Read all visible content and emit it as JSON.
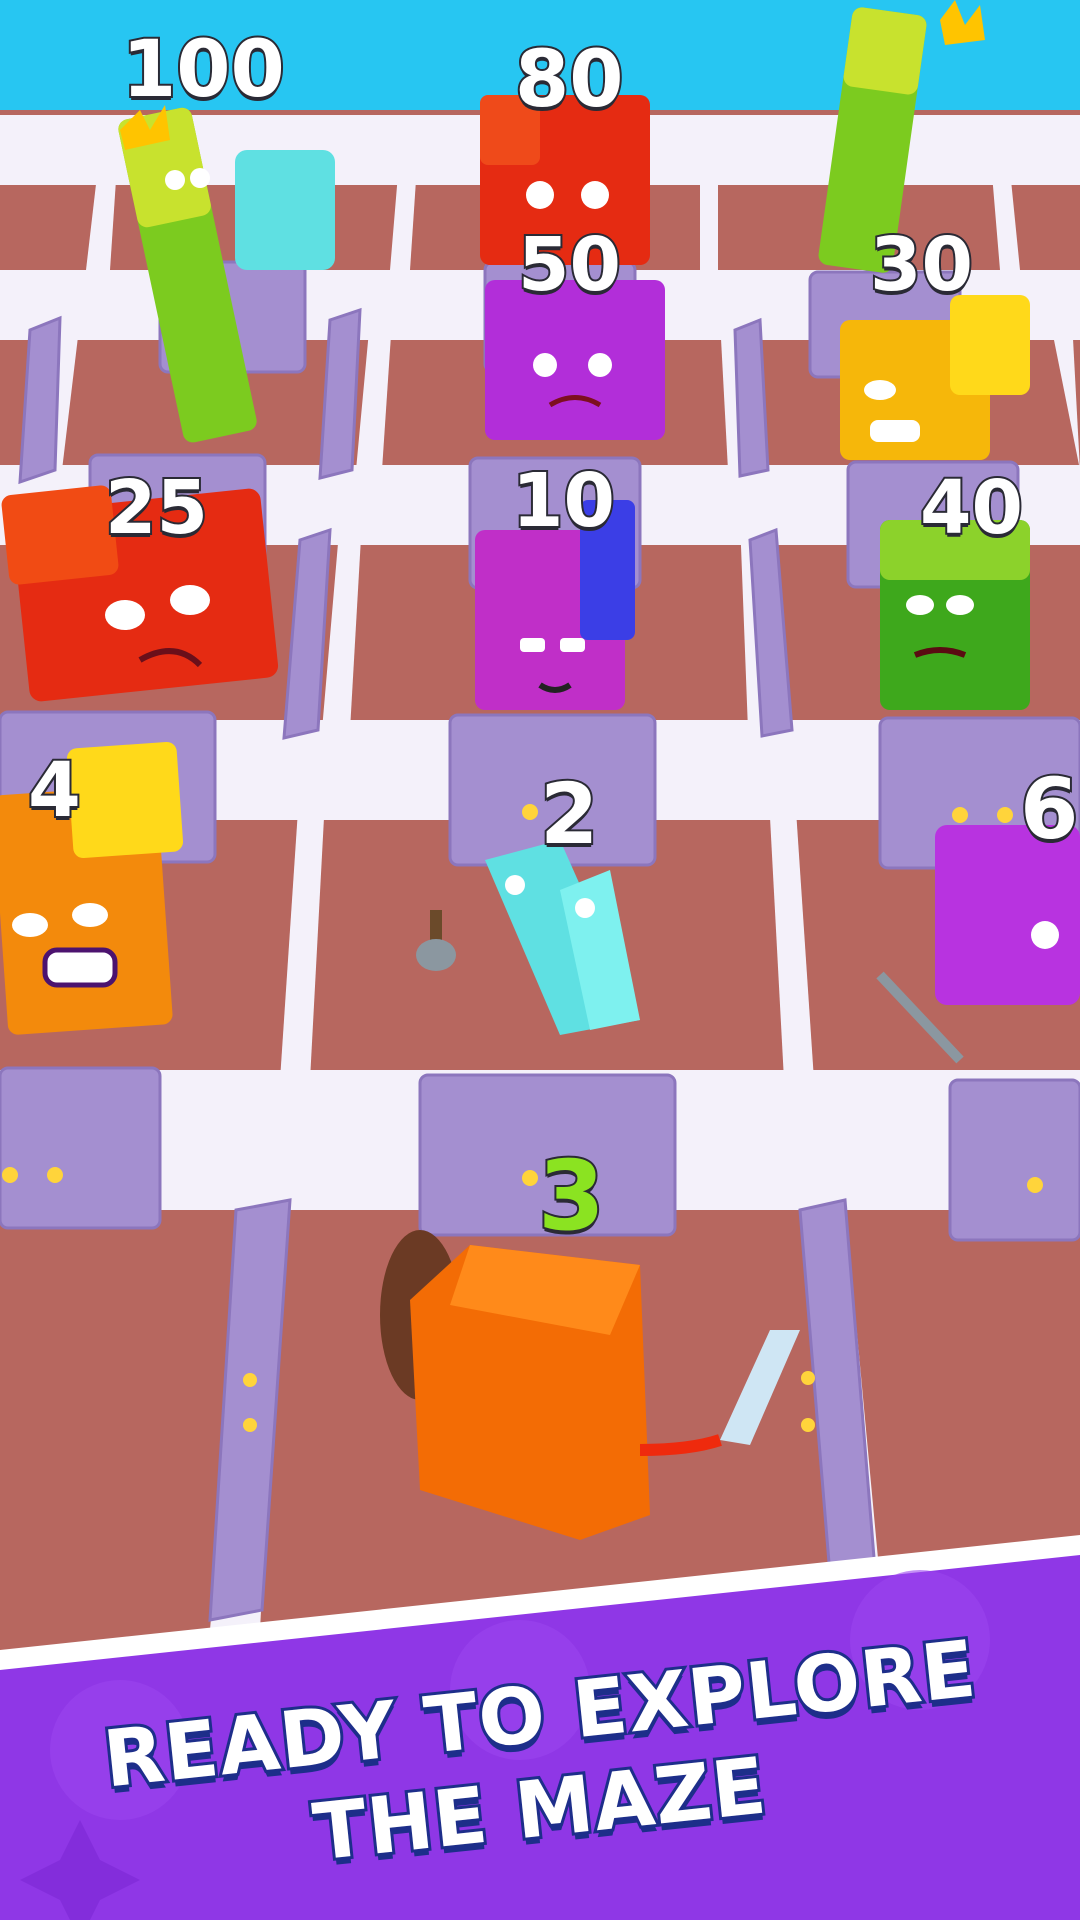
{
  "numbers": {
    "n100": "100",
    "n80": "80",
    "n50": "50",
    "n30": "30",
    "n25": "25",
    "n10": "10",
    "n40": "40",
    "n4": "4",
    "n2": "2",
    "n6": "6",
    "player": "3"
  },
  "banner": {
    "line1": "READY TO EXPLORE",
    "line2": "THE MAZE"
  },
  "colors": {
    "sky": "#27c6f2",
    "floor": "#b7675f",
    "wall": "#f4f1fa",
    "door": "#a48fd0",
    "banner": "#8f37e6",
    "banner_text_outline": "#1d2e8a",
    "player_number": "#8be321"
  }
}
